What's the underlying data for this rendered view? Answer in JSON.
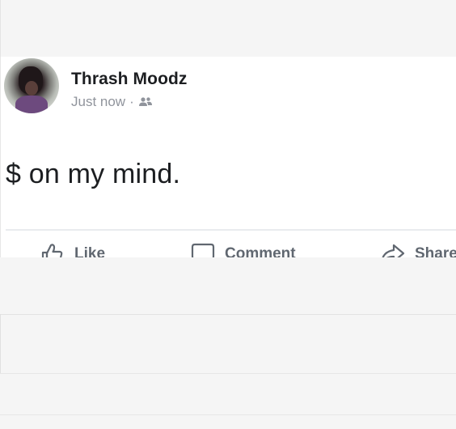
{
  "post": {
    "author": {
      "name": "Thrash Moodz"
    },
    "meta": {
      "timestamp": "Just now",
      "separator": "·",
      "audience_icon": "friends-icon"
    },
    "text": "$ on my mind."
  },
  "actions": {
    "like": {
      "label": "Like",
      "icon": "thumbs-up-icon"
    },
    "comment": {
      "label": "Comment",
      "icon": "speech-bubble-icon"
    },
    "share": {
      "label": "Share",
      "icon": "share-arrow-icon"
    }
  },
  "colors": {
    "text_primary": "#1c1e21",
    "text_secondary": "#90949c",
    "action_text": "#606770",
    "background_gray": "#f5f5f5",
    "divider": "#e9ebee"
  }
}
